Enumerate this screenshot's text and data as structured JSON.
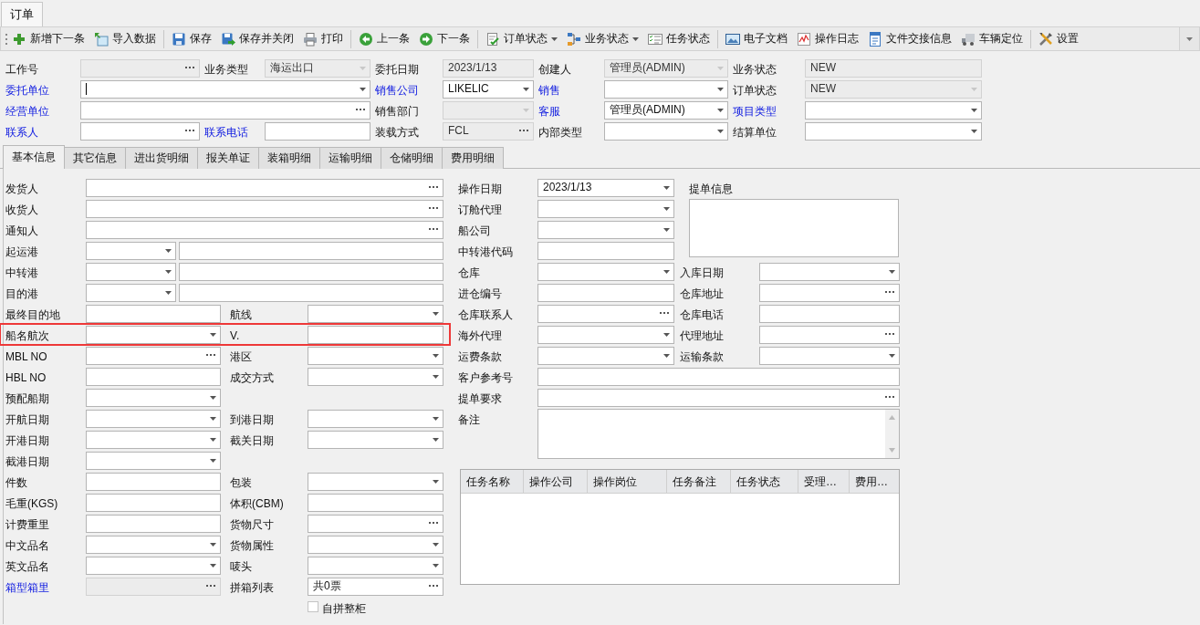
{
  "window": {
    "tab": "订单"
  },
  "toolbar": {
    "groups": [
      [
        {
          "label": "新增下一条",
          "menu": false
        },
        {
          "label": "导入数据",
          "menu": false
        }
      ],
      [
        {
          "label": "保存",
          "menu": false
        },
        {
          "label": "保存并关闭",
          "menu": false
        },
        {
          "label": "打印",
          "menu": false
        }
      ],
      [
        {
          "label": "上一条",
          "menu": false
        },
        {
          "label": "下一条",
          "menu": false
        }
      ],
      [
        {
          "label": "订单状态",
          "menu": true
        },
        {
          "label": "业务状态",
          "menu": true
        },
        {
          "label": "任务状态",
          "menu": false
        }
      ],
      [
        {
          "label": "电子文档",
          "menu": false
        },
        {
          "label": "操作日志",
          "menu": false
        },
        {
          "label": "文件交接信息",
          "menu": false
        },
        {
          "label": "车辆定位",
          "menu": false
        }
      ],
      [
        {
          "label": "设置",
          "menu": false
        }
      ]
    ]
  },
  "header": {
    "rows": [
      [
        {
          "label": "工作号",
          "link": false,
          "field": {
            "kind": "ellipsis",
            "disabled": true
          }
        },
        {
          "label": "业务类型",
          "link": false,
          "field": {
            "kind": "dropdown",
            "value": "海运出口",
            "disabled": true
          }
        },
        {
          "label": "委托日期",
          "link": false,
          "field": {
            "kind": "text",
            "value": "2023/1/13",
            "disabled": true
          }
        },
        {
          "label": "创建人",
          "link": false,
          "field": {
            "kind": "dropdown",
            "value": "管理员(ADMIN)",
            "disabled": true
          }
        },
        {
          "label": "业务状态",
          "link": false,
          "field": {
            "kind": "text",
            "value": "NEW",
            "disabled": true
          }
        }
      ],
      [
        {
          "label": "委托单位",
          "link": true,
          "field": {
            "kind": "dropdown",
            "disabled": false,
            "focused": true
          }
        },
        {
          "label": "销售公司",
          "link": true,
          "field": {
            "kind": "dropdown",
            "value": "LIKELIC",
            "disabled": false
          }
        },
        {
          "label": "销售",
          "link": true,
          "field": {
            "kind": "dropdown",
            "disabled": false
          }
        },
        {
          "label": "订单状态",
          "link": false,
          "field": {
            "kind": "dropdown",
            "value": "NEW",
            "disabled": true
          }
        }
      ],
      [
        {
          "label": "经营单位",
          "link": true,
          "field": {
            "kind": "ellipsis",
            "disabled": false
          }
        },
        {
          "label": "销售部门",
          "link": false,
          "field": {
            "kind": "dropdown",
            "disabled": true
          }
        },
        {
          "label": "客服",
          "link": true,
          "field": {
            "kind": "dropdown",
            "value": "管理员(ADMIN)",
            "disabled": false
          }
        },
        {
          "label": "项目类型",
          "link": true,
          "field": {
            "kind": "dropdown",
            "disabled": false
          }
        }
      ],
      [
        {
          "label": "联系人",
          "link": true,
          "field": {
            "kind": "ellipsis",
            "disabled": false
          }
        },
        {
          "label": "联系电话",
          "link": true,
          "field": {
            "kind": "text",
            "disabled": false
          }
        },
        {
          "label": "装载方式",
          "link": false,
          "field": {
            "kind": "ellipsis",
            "value": "FCL",
            "disabled": true
          }
        },
        {
          "label": "内部类型",
          "link": false,
          "field": {
            "kind": "dropdown",
            "disabled": false
          }
        },
        {
          "label": "结算单位",
          "link": false,
          "field": {
            "kind": "dropdown",
            "disabled": false
          }
        }
      ]
    ]
  },
  "tabs": [
    {
      "label": "基本信息",
      "selected": true
    },
    {
      "label": "其它信息",
      "selected": false
    },
    {
      "label": "进出货明细",
      "selected": false
    },
    {
      "label": "报关单证",
      "selected": false
    },
    {
      "label": "装箱明细",
      "selected": false
    },
    {
      "label": "运输明细",
      "selected": false
    },
    {
      "label": "仓储明细",
      "selected": false
    },
    {
      "label": "费用明细",
      "selected": false
    }
  ],
  "left": {
    "rows": [
      {
        "kind": "wide",
        "highlighted": false,
        "label": "发货人",
        "link": false,
        "field": {
          "kind": "ellipsis",
          "disabled": false
        }
      },
      {
        "kind": "wide",
        "highlighted": false,
        "label": "收货人",
        "link": false,
        "field": {
          "kind": "ellipsis",
          "disabled": false
        }
      },
      {
        "kind": "wide",
        "highlighted": false,
        "label": "通知人",
        "link": false,
        "field": {
          "kind": "ellipsis",
          "disabled": false
        }
      },
      {
        "kind": "port",
        "highlighted": false,
        "label": "起运港",
        "link": false,
        "field": {
          "kind": "dropdown",
          "disabled": false
        },
        "field2": {
          "kind": "text",
          "disabled": false
        }
      },
      {
        "kind": "port",
        "highlighted": false,
        "label": "中转港",
        "link": false,
        "field": {
          "kind": "dropdown",
          "disabled": false
        },
        "field2": {
          "kind": "text",
          "disabled": false
        }
      },
      {
        "kind": "port",
        "highlighted": false,
        "label": "目的港",
        "link": false,
        "field": {
          "kind": "dropdown",
          "disabled": false
        },
        "field2": {
          "kind": "text",
          "disabled": false
        }
      },
      {
        "kind": "pair",
        "highlighted": false,
        "label": "最终目的地",
        "link": false,
        "field": {
          "kind": "text",
          "disabled": false
        },
        "label2": "航线",
        "field2": {
          "kind": "dropdown",
          "disabled": false
        }
      },
      {
        "kind": "pair",
        "highlighted": true,
        "label": "船名航次",
        "link": false,
        "field": {
          "kind": "dropdown",
          "disabled": false
        },
        "label2": "V.",
        "field2": {
          "kind": "text",
          "disabled": false
        }
      },
      {
        "kind": "pair",
        "highlighted": false,
        "label": "MBL NO",
        "link": false,
        "field": {
          "kind": "ellipsis",
          "disabled": false
        },
        "label2": "港区",
        "field2": {
          "kind": "dropdown",
          "disabled": false
        }
      },
      {
        "kind": "pair",
        "highlighted": false,
        "label": "HBL NO",
        "link": false,
        "field": {
          "kind": "text",
          "disabled": false
        },
        "label2": "成交方式",
        "field2": {
          "kind": "dropdown",
          "disabled": false
        }
      },
      {
        "kind": "single",
        "highlighted": false,
        "label": "预配船期",
        "link": false,
        "field": {
          "kind": "dropdown",
          "disabled": false
        }
      },
      {
        "kind": "pair",
        "highlighted": false,
        "label": "开航日期",
        "link": false,
        "field": {
          "kind": "dropdown",
          "disabled": false
        },
        "label2": "到港日期",
        "field2": {
          "kind": "dropdown",
          "disabled": false
        }
      },
      {
        "kind": "pair",
        "highlighted": false,
        "label": "开港日期",
        "link": false,
        "field": {
          "kind": "dropdown",
          "disabled": false
        },
        "label2": "截关日期",
        "field2": {
          "kind": "dropdown",
          "disabled": false
        }
      },
      {
        "kind": "single",
        "highlighted": false,
        "label": "截港日期",
        "link": false,
        "field": {
          "kind": "dropdown",
          "disabled": false
        }
      },
      {
        "kind": "pair",
        "highlighted": false,
        "label": "件数",
        "link": false,
        "field": {
          "kind": "text",
          "disabled": false
        },
        "label2": "包装",
        "field2": {
          "kind": "dropdown",
          "disabled": false
        }
      },
      {
        "kind": "pair",
        "highlighted": false,
        "label": "毛重(KGS)",
        "link": false,
        "field": {
          "kind": "text",
          "disabled": false
        },
        "label2": "体积(CBM)",
        "field2": {
          "kind": "text",
          "disabled": false
        }
      },
      {
        "kind": "pair",
        "highlighted": false,
        "label": "计费重里",
        "link": false,
        "field": {
          "kind": "text",
          "disabled": false
        },
        "label2": "货物尺寸",
        "field2": {
          "kind": "ellipsis",
          "disabled": false
        }
      },
      {
        "kind": "pair",
        "highlighted": false,
        "label": "中文品名",
        "link": false,
        "field": {
          "kind": "dropdown",
          "disabled": false
        },
        "label2": "货物属性",
        "field2": {
          "kind": "dropdown",
          "disabled": false
        }
      },
      {
        "kind": "pair",
        "highlighted": false,
        "label": "英文品名",
        "link": false,
        "field": {
          "kind": "dropdown",
          "disabled": false
        },
        "label2": "唛头",
        "field2": {
          "kind": "dropdown",
          "disabled": false
        }
      },
      {
        "kind": "pair",
        "highlighted": false,
        "label": "箱型箱里",
        "link": true,
        "field": {
          "kind": "ellipsis",
          "disabled": true
        },
        "label2": "拼箱列表",
        "field2": {
          "kind": "ellipsis",
          "value": "共0票",
          "disabled": false
        }
      },
      {
        "kind": "check",
        "highlighted": false,
        "label": "自拼整柜",
        "checked": false
      }
    ]
  },
  "right": {
    "top_rows": [
      {
        "label": "操作日期",
        "field": {
          "kind": "dropdown",
          "value": "2023/1/13",
          "disabled": false
        }
      },
      {
        "label": "订舱代理",
        "field": {
          "kind": "dropdown",
          "disabled": false
        }
      },
      {
        "label": "船公司",
        "field": {
          "kind": "dropdown",
          "disabled": false
        }
      },
      {
        "label": "中转港代码",
        "field": {
          "kind": "text",
          "disabled": false
        }
      }
    ],
    "bill_info": {
      "label": "提单信息",
      "field": {
        "kind": "memo",
        "disabled": false
      }
    },
    "rows": [
      {
        "kind": "pair",
        "label": "仓库",
        "field": {
          "kind": "dropdown",
          "disabled": false
        },
        "label2": "入库日期",
        "field2": {
          "kind": "dropdown",
          "disabled": false
        }
      },
      {
        "kind": "pair",
        "label": "进仓编号",
        "field": {
          "kind": "text",
          "disabled": false
        },
        "label2": "仓库地址",
        "field2": {
          "kind": "ellipsis",
          "disabled": false
        }
      },
      {
        "kind": "pair",
        "label": "仓库联系人",
        "field": {
          "kind": "ellipsis",
          "disabled": false
        },
        "label2": "仓库电话",
        "field2": {
          "kind": "text",
          "disabled": false
        }
      },
      {
        "kind": "pair",
        "label": "海外代理",
        "field": {
          "kind": "dropdown",
          "disabled": false
        },
        "label2": "代理地址",
        "field2": {
          "kind": "ellipsis",
          "disabled": false
        }
      },
      {
        "kind": "pair",
        "label": "运费条款",
        "field": {
          "kind": "dropdown",
          "disabled": false
        },
        "label2": "运输条款",
        "field2": {
          "kind": "dropdown",
          "disabled": false
        }
      },
      {
        "kind": "wide",
        "label": "客户参考号",
        "field": {
          "kind": "text",
          "disabled": false
        }
      },
      {
        "kind": "wide",
        "label": "提单要求",
        "field": {
          "kind": "ellipsis",
          "disabled": false
        }
      },
      {
        "kind": "memo",
        "label": "备注",
        "field": {
          "kind": "scrollmemo",
          "disabled": false
        }
      }
    ],
    "task_table": {
      "columns": [
        "任务名称",
        "操作公司",
        "操作岗位",
        "任务备注",
        "任务状态",
        "受理…",
        "费用…"
      ]
    }
  }
}
